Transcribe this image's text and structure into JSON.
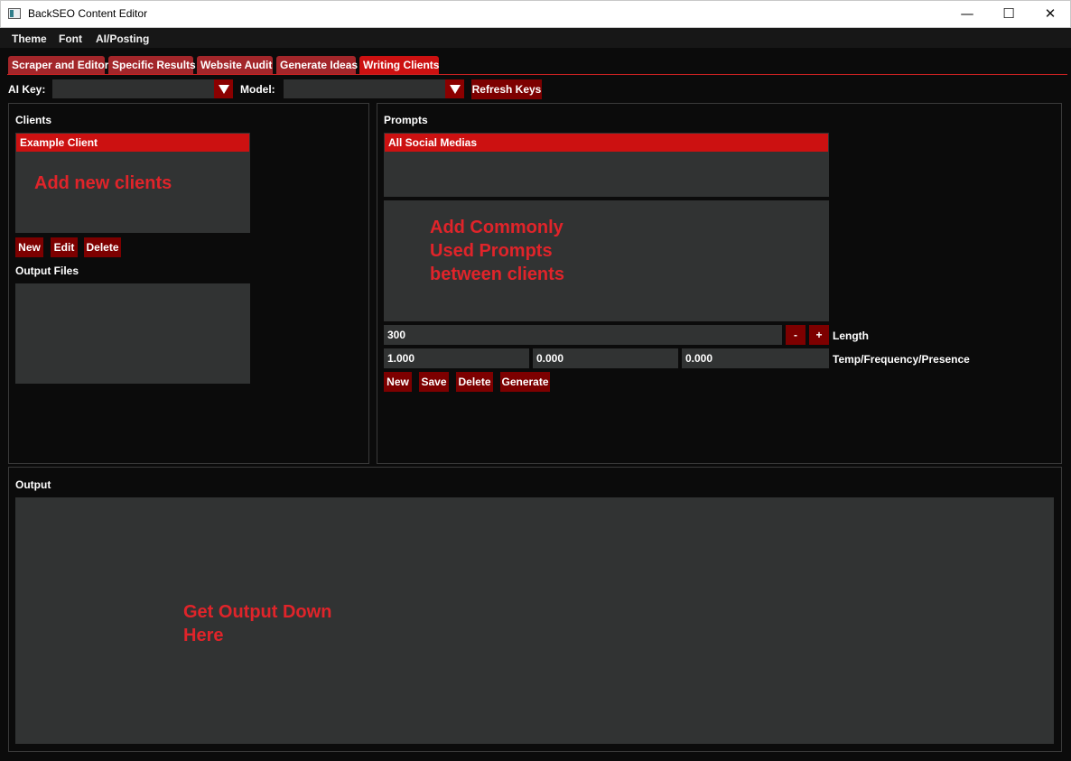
{
  "window": {
    "title": "BackSEO Content Editor",
    "minimize_icon": "minimize-icon",
    "maximize_icon": "maximize-icon",
    "close_icon": "close-icon"
  },
  "menu": [
    "Theme",
    "Font",
    "AI/Posting"
  ],
  "tabs": [
    {
      "label": "Scraper and Editor",
      "active": false
    },
    {
      "label": "Specific Results",
      "active": false
    },
    {
      "label": "Website Audit",
      "active": false
    },
    {
      "label": "Generate Ideas",
      "active": false
    },
    {
      "label": "Writing Clients",
      "active": true
    }
  ],
  "toolbar": {
    "ai_key_label": "AI Key:",
    "ai_key_value": "",
    "model_label": "Model:",
    "model_value": "",
    "refresh_label": "Refresh Keys"
  },
  "clients": {
    "title": "Clients",
    "items": [
      "Example Client"
    ],
    "annotation": "Add new clients",
    "buttons": {
      "new": "New",
      "edit": "Edit",
      "delete": "Delete"
    },
    "output_files_title": "Output Files"
  },
  "prompts": {
    "title": "Prompts",
    "items": [
      "All Social Medias"
    ],
    "annotation": "Add Commonly\nUsed Prompts\nbetween clients",
    "length_value": "300",
    "minus": "-",
    "plus": "+",
    "length_label": "Length",
    "temperature": "1.000",
    "frequency": "0.000",
    "presence": "0.000",
    "tfp_label": "Temp/Frequency/Presence",
    "buttons": {
      "new": "New",
      "save": "Save",
      "delete": "Delete",
      "generate": "Generate"
    }
  },
  "output": {
    "title": "Output",
    "annotation": "Get Output Down\nHere"
  },
  "colors": {
    "accent": "#cc1111",
    "button": "#7d0000",
    "annotation": "#e0242a",
    "field": "#313333",
    "background": "#0b0b0b"
  }
}
